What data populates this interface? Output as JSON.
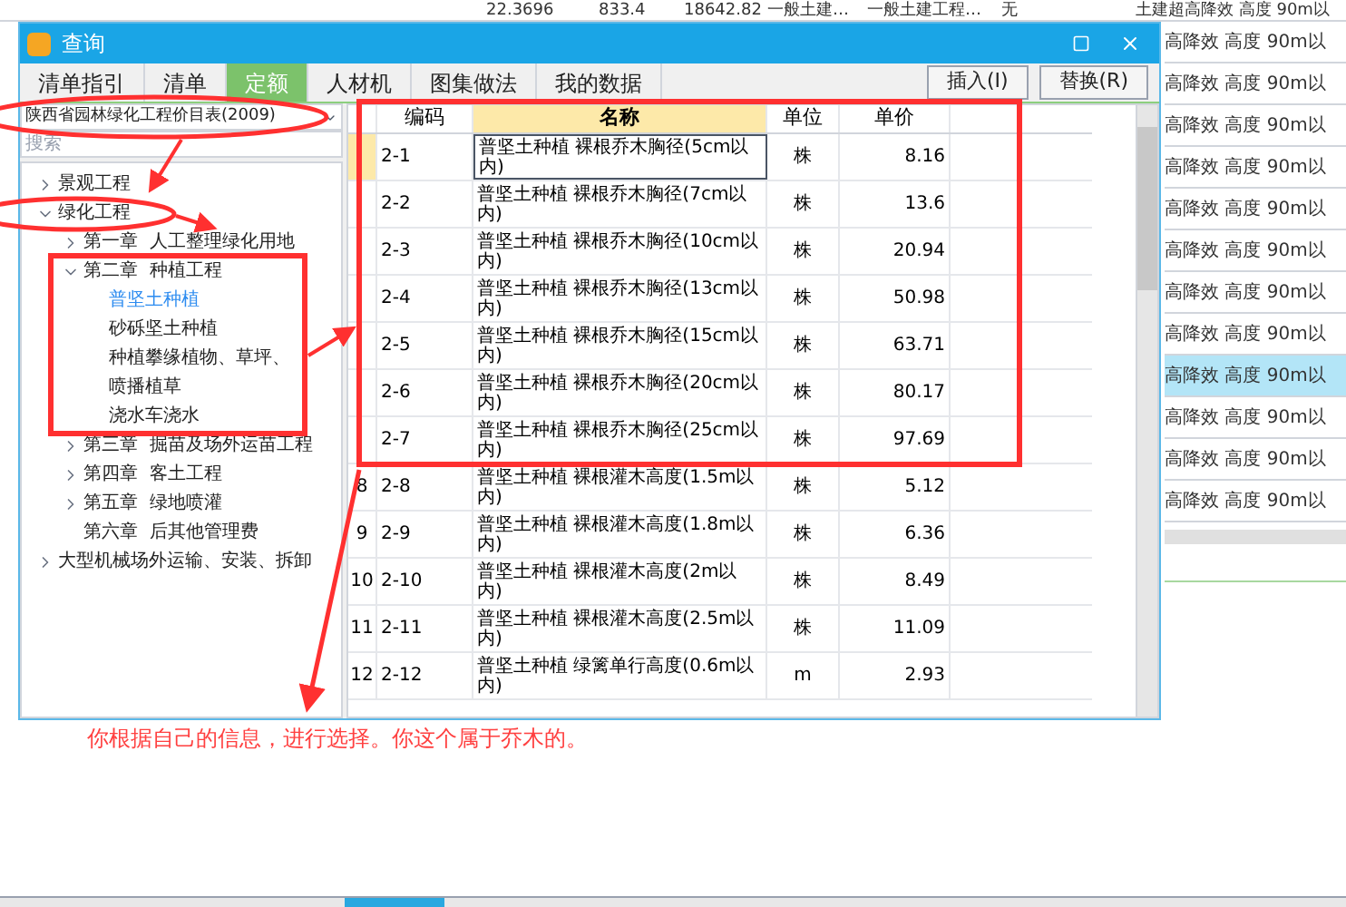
{
  "background": {
    "top_row": [
      "22.3696",
      "833.4",
      "18642.82",
      "一般土建…",
      "一般土建工程…",
      "无",
      "土建超高降效 高度 90m以"
    ],
    "right_rows": [
      {
        "text": "高降效 高度 90m以",
        "selected": false
      },
      {
        "text": "高降效 高度 90m以",
        "selected": false
      },
      {
        "text": "高降效 高度 90m以",
        "selected": false
      },
      {
        "text": "高降效 高度 90m以",
        "selected": false
      },
      {
        "text": "高降效 高度 90m以",
        "selected": false
      },
      {
        "text": "高降效 高度 90m以",
        "selected": false
      },
      {
        "text": "高降效 高度 90m以",
        "selected": false
      },
      {
        "text": "高降效 高度 90m以",
        "selected": false
      },
      {
        "text": "高降效 高度 90m以",
        "selected": true
      },
      {
        "text": "高降效 高度 90m以",
        "selected": false
      },
      {
        "text": "高降效 高度 90m以",
        "selected": false
      },
      {
        "text": "高降效 高度 90m以",
        "selected": false
      }
    ]
  },
  "window": {
    "title": "查询"
  },
  "tabs": [
    {
      "label": "清单指引",
      "selected": false
    },
    {
      "label": "清单",
      "selected": false
    },
    {
      "label": "定额",
      "selected": true
    },
    {
      "label": "人材机",
      "selected": false
    },
    {
      "label": "图集做法",
      "selected": false
    },
    {
      "label": "我的数据",
      "selected": false
    }
  ],
  "buttons": [
    "插入(I)",
    "替换(R)"
  ],
  "library_select": {
    "value": "陕西省园林绿化工程价目表(2009)"
  },
  "search": {
    "placeholder": "搜索"
  },
  "tree": [
    {
      "label": "景观工程",
      "expanded": false,
      "selected": false
    },
    {
      "label": "绿化工程",
      "expanded": true,
      "selected": false,
      "children": [
        {
          "label": "第一章  人工整理绿化用地",
          "expanded": false,
          "selected": false
        },
        {
          "label": "第二章  种植工程",
          "expanded": true,
          "selected": false,
          "children": [
            {
              "label": "普坚土种植",
              "selected": true
            },
            {
              "label": "砂砾坚土种植",
              "selected": false
            },
            {
              "label": "种植攀缘植物、草坪、",
              "selected": false
            },
            {
              "label": "喷播植草",
              "selected": false
            },
            {
              "label": "浇水车浇水",
              "selected": false
            }
          ]
        },
        {
          "label": "第三章  掘苗及场外运苗工程",
          "expanded": false,
          "selected": false
        },
        {
          "label": "第四章  客土工程",
          "expanded": false,
          "selected": false
        },
        {
          "label": "第五章  绿地喷灌",
          "expanded": false,
          "selected": false
        },
        {
          "label": "第六章  后其他管理费",
          "selected": false
        }
      ]
    },
    {
      "label": "大型机械场外运输、安装、拆卸",
      "expanded": false,
      "selected": false
    }
  ],
  "table": {
    "columns": [
      {
        "label": "编码",
        "selected": false
      },
      {
        "label": "名称",
        "selected": true
      },
      {
        "label": "单位",
        "selected": false
      },
      {
        "label": "单价",
        "selected": false
      }
    ],
    "rows": [
      {
        "code": "2-1",
        "name": "普坚土种植  裸根乔木胸径(5cm以内)",
        "unit": "株",
        "price": "8.16",
        "selected": true
      },
      {
        "code": "2-2",
        "name": "普坚土种植  裸根乔木胸径(7cm以内)",
        "unit": "株",
        "price": "13.6",
        "selected": false
      },
      {
        "code": "2-3",
        "name": "普坚土种植  裸根乔木胸径(10cm以内)",
        "unit": "株",
        "price": "20.94",
        "selected": false
      },
      {
        "code": "2-4",
        "name": "普坚土种植  裸根乔木胸径(13cm以内)",
        "unit": "株",
        "price": "50.98",
        "selected": false
      },
      {
        "code": "2-5",
        "name": "普坚土种植  裸根乔木胸径(15cm以内)",
        "unit": "株",
        "price": "63.71",
        "selected": false
      },
      {
        "code": "2-6",
        "name": "普坚土种植  裸根乔木胸径(20cm以内)",
        "unit": "株",
        "price": "80.17",
        "selected": false
      },
      {
        "code": "2-7",
        "name": "普坚土种植  裸根乔木胸径(25cm以内)",
        "unit": "株",
        "price": "97.69",
        "selected": false
      },
      {
        "number": "8",
        "code": "2-8",
        "name": "普坚土种植  裸根灌木高度(1.5m以内)",
        "unit": "株",
        "price": "5.12",
        "selected": false
      },
      {
        "number": "9",
        "code": "2-9",
        "name": "普坚土种植  裸根灌木高度(1.8m以内)",
        "unit": "株",
        "price": "6.36",
        "selected": false
      },
      {
        "number": "10",
        "code": "2-10",
        "name": "普坚土种植  裸根灌木高度(2m以内)",
        "unit": "株",
        "price": "8.49",
        "selected": false
      },
      {
        "number": "11",
        "code": "2-11",
        "name": "普坚土种植  裸根灌木高度(2.5m以内)",
        "unit": "株",
        "price": "11.09",
        "selected": false
      },
      {
        "number": "12",
        "code": "2-12",
        "name": "普坚土种植  绿篱单行高度(0.6m以内)",
        "unit": "m",
        "price": "2.93",
        "selected": false
      }
    ]
  },
  "annotation": {
    "text": "你根据自己的信息，进行选择。你这个属于乔木的。"
  }
}
